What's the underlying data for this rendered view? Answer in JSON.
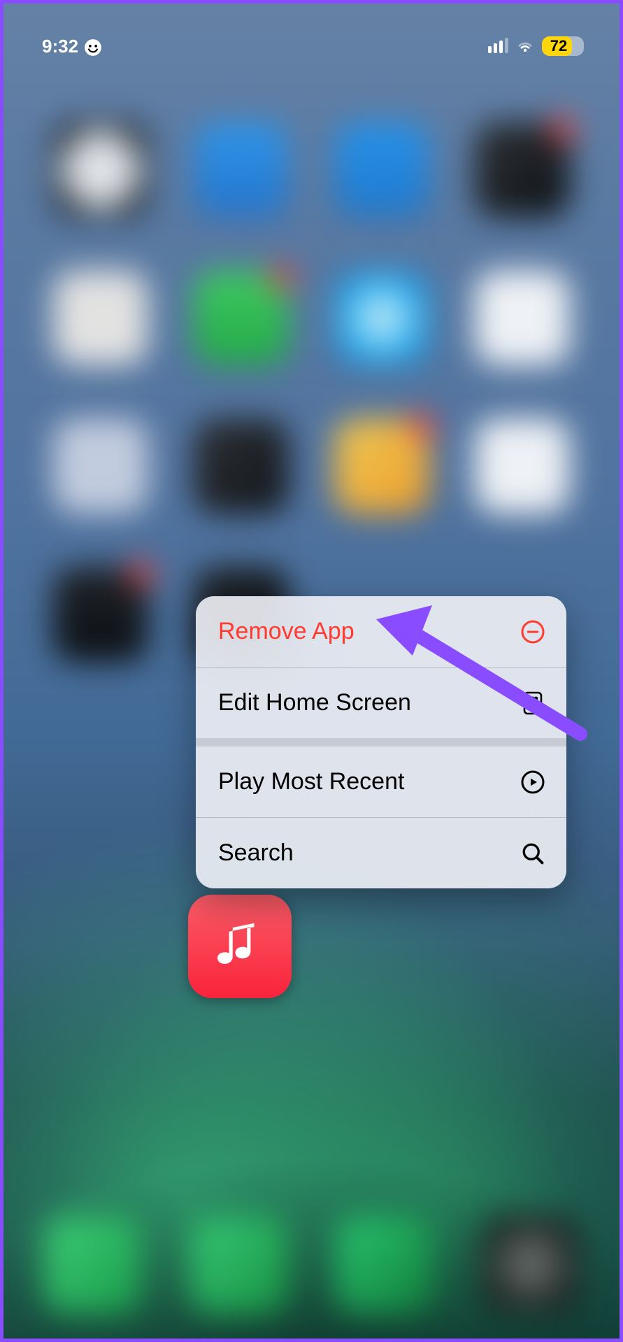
{
  "status_bar": {
    "time": "9:32",
    "battery_pct": "72"
  },
  "context_menu": {
    "items": [
      {
        "label": "Remove App",
        "destructive": true,
        "icon": "minus-circle"
      },
      {
        "label": "Edit Home Screen",
        "destructive": false,
        "icon": "grid"
      },
      {
        "label": "Play Most Recent",
        "destructive": false,
        "icon": "play-circle"
      },
      {
        "label": "Search",
        "destructive": false,
        "icon": "search"
      }
    ]
  },
  "focused_app": {
    "name": "Music"
  },
  "bg_icons": [
    {
      "bg": "radial-gradient(circle at 50% 50%, #fff 0%, #d6d6d6 60%, #111 61%)"
    },
    {
      "bg": "linear-gradient(180deg,#2999f3,#1f74d0)"
    },
    {
      "bg": "linear-gradient(180deg,#2196f3,#1a78d0)"
    },
    {
      "bg": "linear-gradient(135deg,#2b2b2b,#050505)",
      "badge": true
    },
    {
      "bg": "#f2eee9"
    },
    {
      "bg": "linear-gradient(180deg,#3cd35a,#1daf3e)",
      "badge": true
    },
    {
      "bg": "radial-gradient(circle at 50% 50%, #fff 5%, #3ec8ff 45%, #0a7dd8 90%)"
    },
    {
      "bg": "#ffffff"
    },
    {
      "bg": "#cfd6e6"
    },
    {
      "bg": "linear-gradient(135deg,#2a2a2a,#0b0b0b)"
    },
    {
      "bg": "linear-gradient(135deg,#ffd24d,#ffa21f)",
      "badge": true
    },
    {
      "bg": "#ffffff"
    },
    {
      "bg": "linear-gradient(180deg,#1b1b1b,#050505)",
      "badge": true
    },
    {
      "bg": "linear-gradient(135deg,#1e1e1e,#060606)"
    },
    {
      "bg": "",
      "hidden": true
    },
    {
      "bg": "",
      "hidden": true
    },
    {
      "bg": "",
      "hidden": true
    },
    {
      "bg": "",
      "hidden": true
    },
    {
      "bg": "",
      "hidden": true
    },
    {
      "bg": "",
      "hidden": true
    }
  ],
  "dock_icons": [
    {
      "bg": "linear-gradient(135deg,#40d97c,#1aa34a)"
    },
    {
      "bg": "linear-gradient(135deg,#39d27b,#179a42)"
    },
    {
      "bg": "linear-gradient(135deg,#2ad174,#11823a)"
    },
    {
      "bg": "radial-gradient(circle at 50% 50%, #777 10%, #1b1b1b 70%)"
    }
  ],
  "colors": {
    "destructive": "#ff3b30"
  }
}
